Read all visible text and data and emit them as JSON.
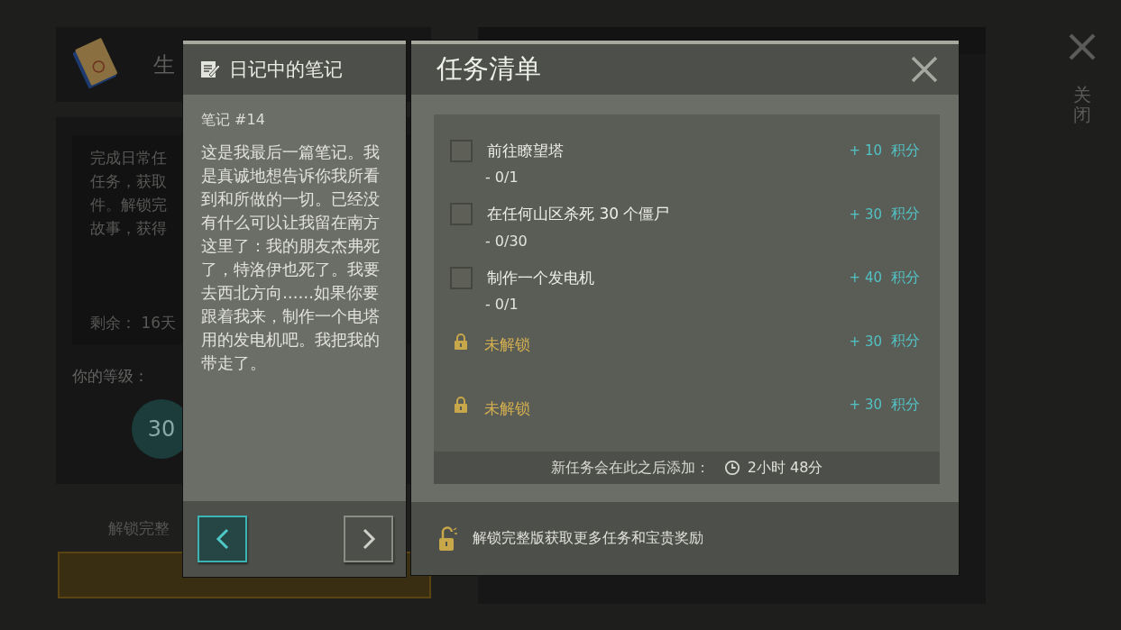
{
  "background": {
    "header_title": "生",
    "description_lines": [
      "完成日常任",
      "任务，获取",
      "件。解锁完",
      "故事，获得"
    ],
    "remaining": "剩余： 16天",
    "level_label": "你的等级：",
    "level_value": "30",
    "unlock_caption": "解锁完整"
  },
  "close": {
    "label": "关闭"
  },
  "note": {
    "title": "日记中的笔记",
    "number": "笔记 #14",
    "body": "这是我最后一篇笔记。我是真诚地想告诉你我所看到和所做的一切。已经没有什么可以让我留在南方这里了：我的朋友杰弗死了，特洛伊也死了。我要去西北方向……如果你要跟着我来，制作一个电塔用的发电机吧。我把我的带走了。",
    "nav": [
      {
        "kind": "prev",
        "highlighted": true
      },
      {
        "kind": "next",
        "highlighted": false
      }
    ]
  },
  "tasks": {
    "title": "任务清单",
    "items": [
      {
        "kind": "task",
        "checked": false,
        "label": "前往瞭望塔",
        "progress": "- 0/1",
        "points": "+ 10",
        "unit": "积分"
      },
      {
        "kind": "task",
        "checked": false,
        "label": "在任何山区杀死 30 个僵尸",
        "progress": "- 0/30",
        "points": "+ 30",
        "unit": "积分"
      },
      {
        "kind": "task",
        "checked": false,
        "label": "制作一个发电机",
        "progress": "- 0/1",
        "points": "+ 40",
        "unit": "积分"
      },
      {
        "kind": "locked",
        "label": "未解锁",
        "points": "+ 30",
        "unit": "积分"
      },
      {
        "kind": "locked",
        "label": "未解锁",
        "points": "+ 30",
        "unit": "积分"
      }
    ],
    "footer_label": "新任务会在此之后添加：",
    "footer_time": "2小时 48分",
    "promo": "解锁完整版获取更多任务和宝贵奖励"
  }
}
